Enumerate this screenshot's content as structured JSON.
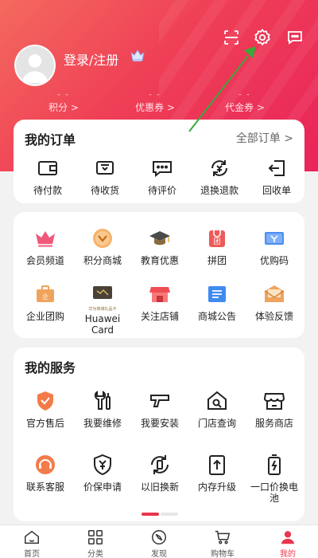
{
  "header": {
    "scan_icon": "scan-icon",
    "settings_icon": "gear-icon",
    "message_icon": "chat-icon",
    "login_text": "登录/注册",
    "stats": [
      {
        "value": "- -",
        "label": "积分 >"
      },
      {
        "value": "- -",
        "label": "优惠券 >"
      },
      {
        "value": "- -",
        "label": "代金券 >"
      }
    ],
    "accent": "#ef3f56"
  },
  "orders": {
    "title": "我的订单",
    "all_link": "全部订单  >",
    "items": [
      {
        "label": "待付款",
        "icon": "wallet-icon"
      },
      {
        "label": "待收货",
        "icon": "truck-icon"
      },
      {
        "label": "待评价",
        "icon": "comment-icon"
      },
      {
        "label": "退换退款",
        "icon": "refund-icon"
      },
      {
        "label": "回收单",
        "icon": "recycle-exit-icon"
      }
    ]
  },
  "features": {
    "items": [
      {
        "label": "会员频道",
        "icon": "crown-icon"
      },
      {
        "label": "积分商城",
        "icon": "points-icon"
      },
      {
        "label": "教育优惠",
        "icon": "graduation-cap-icon"
      },
      {
        "label": "拼团",
        "icon": "group-buy-icon"
      },
      {
        "label": "优购码",
        "icon": "voucher-code-icon"
      },
      {
        "label": "企业团购",
        "icon": "enterprise-icon"
      },
      {
        "label": "Huawei Card",
        "icon": "gift-card-icon",
        "card_caption": "华为商城礼品卡"
      },
      {
        "label": "关注店铺",
        "icon": "store-icon"
      },
      {
        "label": "商城公告",
        "icon": "announcement-icon"
      },
      {
        "label": "体验反馈",
        "icon": "feedback-icon"
      }
    ]
  },
  "services": {
    "title": "我的服务",
    "items": [
      {
        "label": "官方售后",
        "icon": "after-sales-icon"
      },
      {
        "label": "我要维修",
        "icon": "repair-icon"
      },
      {
        "label": "我要安装",
        "icon": "install-icon"
      },
      {
        "label": "门店查询",
        "icon": "store-search-icon"
      },
      {
        "label": "服务商店",
        "icon": "service-store-icon"
      },
      {
        "label": "联系客服",
        "icon": "customer-service-icon"
      },
      {
        "label": "价保申请",
        "icon": "price-protect-icon"
      },
      {
        "label": "以旧换新",
        "icon": "trade-in-icon"
      },
      {
        "label": "内存升级",
        "icon": "memory-upgrade-icon"
      },
      {
        "label": "一口价换电池",
        "icon": "battery-icon"
      }
    ]
  },
  "tabbar": {
    "items": [
      {
        "label": "首页",
        "icon": "home-icon",
        "active": false
      },
      {
        "label": "分类",
        "icon": "category-icon",
        "active": false
      },
      {
        "label": "发现",
        "icon": "discover-icon",
        "active": false
      },
      {
        "label": "购物车",
        "icon": "cart-icon",
        "active": false
      },
      {
        "label": "我的",
        "icon": "profile-icon",
        "active": true
      }
    ]
  },
  "annotation": {
    "arrow_color": "#3aa83a"
  }
}
